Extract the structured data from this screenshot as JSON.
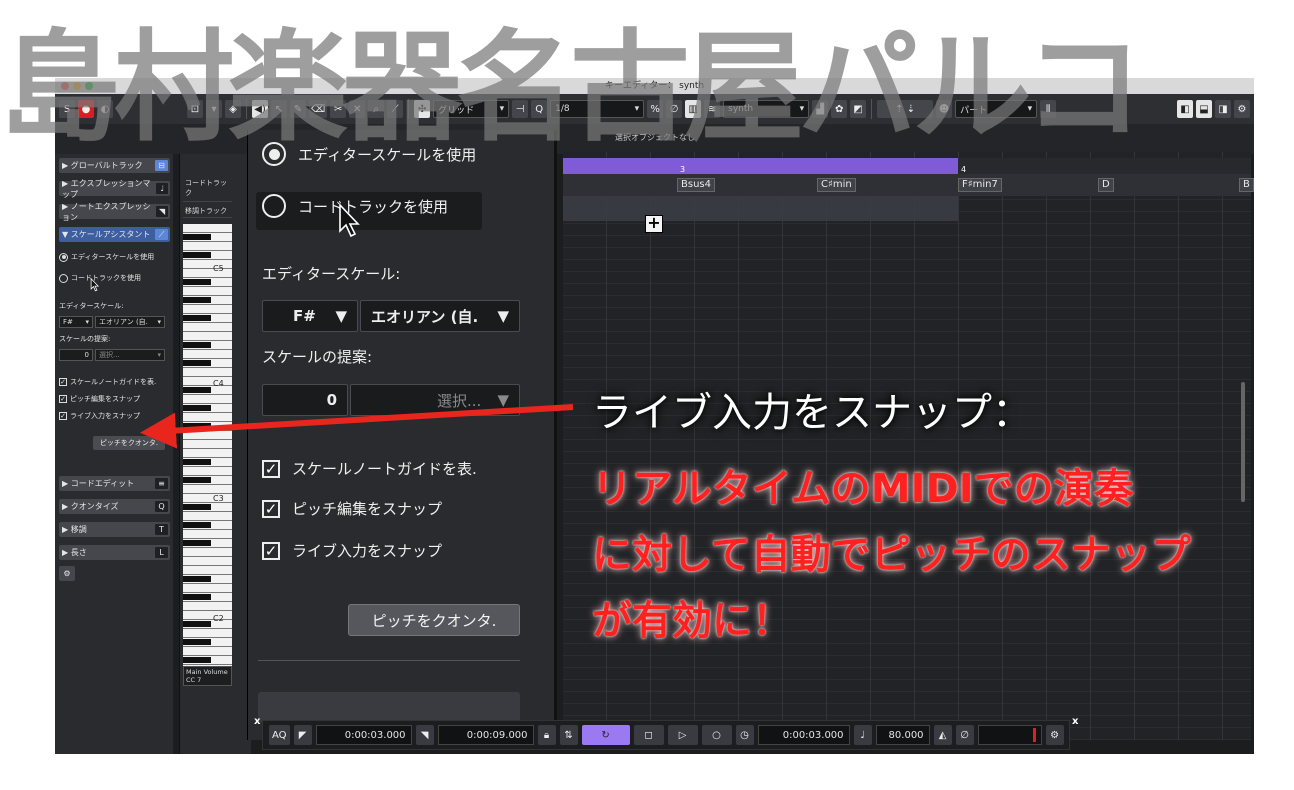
{
  "watermark": "島村楽器名古屋パルコ",
  "window": {
    "title": "キーエディター： synth"
  },
  "toolbar": {
    "snap_type": "グリッド",
    "quantize": "1/8",
    "track": "synth",
    "part": "パート"
  },
  "infobar": {
    "status": "選択オブジェクトなし"
  },
  "inspector": {
    "sections": [
      {
        "label": "▶ グローバルトラック",
        "icon": "⊟"
      },
      {
        "label": "▶ エクスプレッションマップ",
        "icon": "♩"
      },
      {
        "label": "▶ ノートエクスプレッション",
        "icon": "◥"
      },
      {
        "label": "▼ スケールアシスタント",
        "icon": "⟋"
      }
    ],
    "radio_editor_scale": "エディタースケールを使用",
    "radio_chord_track": "コードトラックを使用",
    "editor_scale_label": "エディタースケール:",
    "scale_root": "F#",
    "scale_mode": "エオリアン (自.",
    "scale_suggest_label": "スケールの提案:",
    "suggest_value": "0",
    "suggest_select": "選択...",
    "check_guide": "スケールノートガイドを表.",
    "check_pitch": "ピッチ編集をスナップ",
    "check_live": "ライブ入力をスナップ",
    "quantize_button": "ピッチをクオンタ.",
    "sections_bottom": [
      {
        "label": "▶ コードエディット",
        "icon": "≡"
      },
      {
        "label": "▶ クオンタイズ",
        "icon": "Q"
      },
      {
        "label": "▶ 移調",
        "icon": "T"
      },
      {
        "label": "▶ 長さ",
        "icon": "L"
      }
    ]
  },
  "tracklist": {
    "chord_track": "コードトラック",
    "transpose_track": "移調トラック",
    "key_labels": [
      "C5",
      "C4",
      "C3",
      "C2"
    ],
    "main_volume": "Main Volume",
    "cc": "CC 7"
  },
  "zoom": {
    "radio_editor_scale": "エディタースケールを使用",
    "radio_chord_track": "コードトラックを使用",
    "editor_scale_label": "エディタースケール:",
    "scale_root": "F#",
    "scale_mode": "エオリアン (自.",
    "scale_suggest_label": "スケールの提案:",
    "suggest_value": "0",
    "suggest_select": "選択...",
    "check_guide": "スケールノートガイドを表.",
    "check_pitch": "ピッチ編集をスナップ",
    "check_live": "ライブ入力をスナップ",
    "quantize_button": "ピッチをクオンタ."
  },
  "ruler": {
    "bar3": "3",
    "bar4": "4"
  },
  "chords": [
    {
      "label": "Bsus4"
    },
    {
      "label": "C♯min"
    },
    {
      "label": "F♯min7"
    },
    {
      "label": "D"
    },
    {
      "label": "B"
    }
  ],
  "transport": {
    "aq": "AQ",
    "left_locator": "0:00:03.000",
    "right_locator": "0:00:09.000",
    "position": "0:00:03.000",
    "tempo": "80.000"
  },
  "callouts": {
    "line1": "ライブ入力をスナップ：",
    "line2": "リアルタイムのMIDIでの演奏",
    "line3": "に対して自動でピッチのスナップ",
    "line4": "が有効に！"
  },
  "colors": {
    "accent_purple": "#7f5bd7",
    "callout_red": "#ff2020",
    "arrow_red": "#e8261e",
    "record_red": "#d81e1e"
  }
}
